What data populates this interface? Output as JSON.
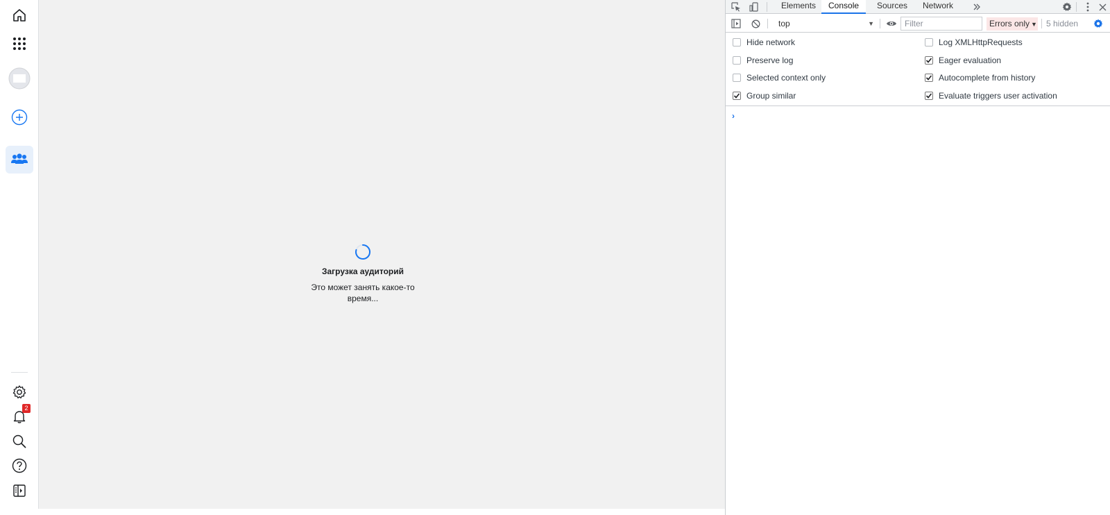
{
  "loader": {
    "title": "Загрузка аудиторий",
    "subtitle": "Это может занять какое-то время..."
  },
  "notifications": {
    "count": "2"
  },
  "colors": {
    "accent": "#1a73e8",
    "nav_blue": "#1877f2",
    "badge": "#e02828"
  },
  "devtools": {
    "tabs": [
      {
        "label": "Elements",
        "active": false
      },
      {
        "label": "Console",
        "active": true
      },
      {
        "label": "Sources",
        "active": false
      },
      {
        "label": "Network",
        "active": false
      }
    ],
    "more_tabs_icon": "chevron-double-right-icon",
    "toolbar": {
      "context": "top",
      "filter_placeholder": "Filter",
      "levels": "Errors only",
      "hidden": "5 hidden"
    },
    "settings_left": [
      {
        "label": "Hide network",
        "checked": false
      },
      {
        "label": "Preserve log",
        "checked": false
      },
      {
        "label": "Selected context only",
        "checked": false
      },
      {
        "label": "Group similar",
        "checked": true
      }
    ],
    "settings_right": [
      {
        "label": "Log XMLHttpRequests",
        "checked": false
      },
      {
        "label": "Eager evaluation",
        "checked": true
      },
      {
        "label": "Autocomplete from history",
        "checked": true
      },
      {
        "label": "Evaluate triggers user activation",
        "checked": true
      }
    ],
    "prompt": "›"
  }
}
